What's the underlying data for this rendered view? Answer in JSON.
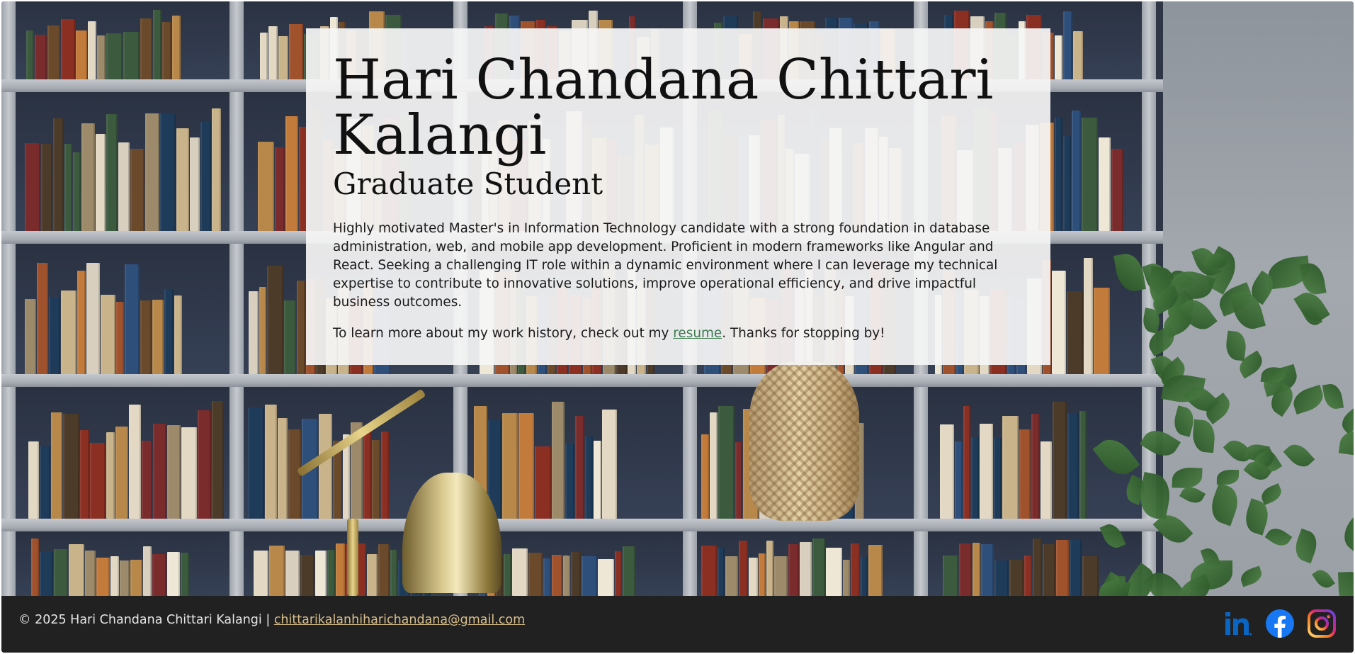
{
  "hero": {
    "name": "Hari Chandana Chittari Kalangi",
    "role": "Graduate Student",
    "summary": "Highly motivated Master's in Information Technology candidate with a strong foundation in database administration, web, and mobile app development. Proficient in modern frameworks like Angular and React. Seeking a challenging IT role within a dynamic environment where I can leverage my technical expertise to contribute to innovative solutions, improve operational efficiency, and drive impactful business outcomes.",
    "cta_before": "To learn more about my work history, check out my ",
    "cta_link": "resume",
    "cta_after": ". Thanks for stopping by!"
  },
  "footer": {
    "copyright": "© 2025 Hari Chandana Chittari Kalangi | ",
    "email": "chittarikalanhiharichandana@gmail.com",
    "social": [
      {
        "name": "linkedin-icon",
        "color": "#0a66c2"
      },
      {
        "name": "facebook-icon",
        "color": "#1877f2"
      },
      {
        "name": "instagram-icon",
        "color": "#e1306c"
      }
    ]
  },
  "colors": {
    "hero_bg": "#f5f5f5",
    "footer_bg": "#212121",
    "resume_link": "#3d7a4f",
    "email_link": "#d9bf8c"
  }
}
